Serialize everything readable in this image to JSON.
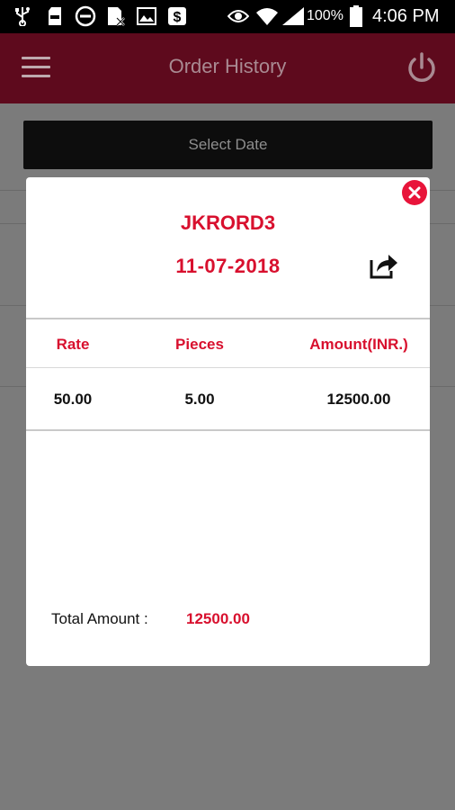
{
  "status_bar": {
    "battery_percent": "100%",
    "time": "4:06 PM",
    "icons": [
      "usb-icon",
      "sd-card-icon",
      "do-not-disturb-icon",
      "no-sim-icon",
      "image-icon",
      "dollar-app-icon",
      "eye-icon",
      "wifi-icon",
      "signal-icon",
      "battery-icon"
    ]
  },
  "app_bar": {
    "title": "Order History",
    "menu_icon": "hamburger-menu-icon",
    "power_icon": "power-icon"
  },
  "filter": {
    "select_date_label": "Select Date"
  },
  "dialog": {
    "order_number": "JKRORD3",
    "order_date": "11-07-2018",
    "share_icon": "share-icon",
    "close_icon": "close-icon",
    "table": {
      "headers": [
        "Rate",
        "Pieces",
        "Amount(INR.)"
      ],
      "rows": [
        [
          "50.00",
          "5.00",
          "12500.00"
        ]
      ]
    },
    "total_label": "Total Amount :",
    "total_value": "12500.00"
  },
  "colors": {
    "accent_red": "#d8102e",
    "app_bar_dimmed": "#5e0a1d",
    "close_button": "#e8143a"
  }
}
